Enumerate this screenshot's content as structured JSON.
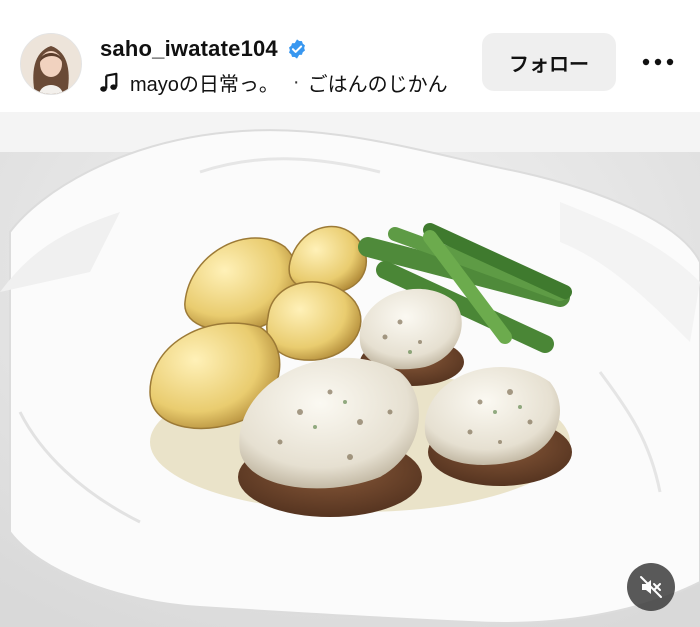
{
  "post_header": {
    "username": "saho_iwatate104",
    "verified": true,
    "music_track": "mayoの日常っ。",
    "separator": "·",
    "audio_label": "ごはんのじかん",
    "follow_label": "フォロー",
    "more_icon": "more-horizontal-icon"
  },
  "media": {
    "type": "photo",
    "subject": "food",
    "mute_icon": "speaker-muted-icon"
  },
  "colors": {
    "verified_badge": "#3897f0",
    "follow_button_bg": "#efefef"
  }
}
